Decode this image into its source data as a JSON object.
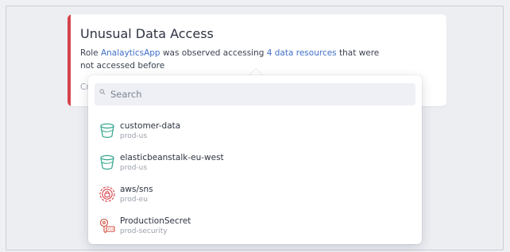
{
  "alert": {
    "title": "Unusual Data Access",
    "desc_prefix": "Role ",
    "role_link": "AnalayticsApp",
    "desc_middle": " was observed accessing ",
    "resources_link": "4 data resources",
    "desc_suffix": " that were not accessed before",
    "cut_text": "Cr",
    "accent_color": "#d8414b"
  },
  "search": {
    "placeholder": "Search",
    "value": ""
  },
  "resources": [
    {
      "name": "customer-data",
      "env": "prod-us",
      "icon": "bucket-icon",
      "color": "#2fa58a"
    },
    {
      "name": "elasticbeanstalk-eu-west",
      "env": "prod-us",
      "icon": "bucket-icon",
      "color": "#2fa58a"
    },
    {
      "name": "aws/sns",
      "env": "prod-eu",
      "icon": "kms-lock-icon",
      "color": "#d8414b"
    },
    {
      "name": "ProductionSecret",
      "env": "prod-security",
      "icon": "secret-key-icon",
      "color": "#d24a3a"
    }
  ]
}
